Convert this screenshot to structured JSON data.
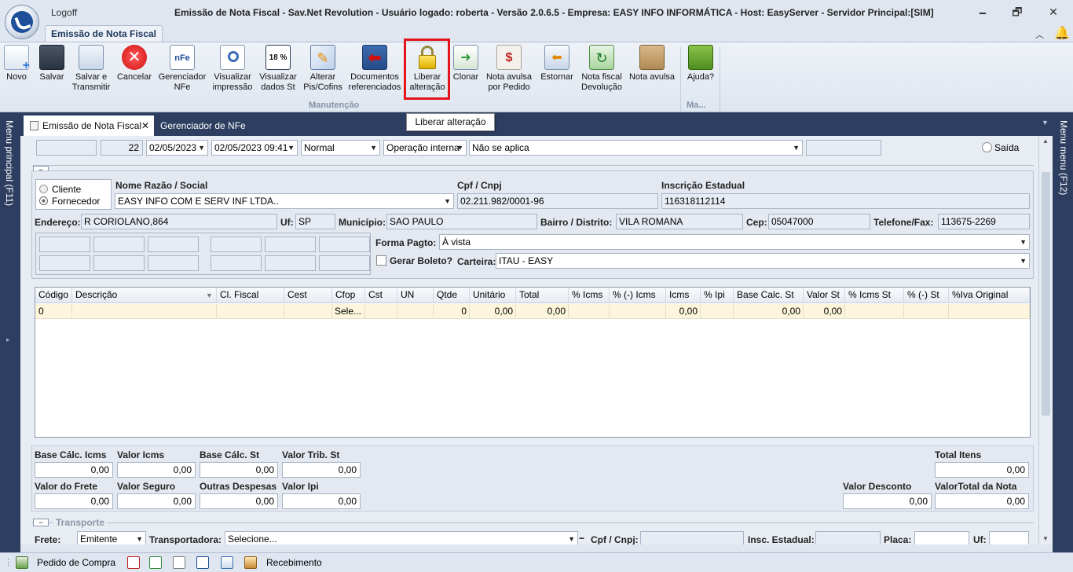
{
  "titlebar": {
    "logoff": "Logoff",
    "title": "Emissão de Nota Fiscal - Sav.Net Revolution - Usuário logado: roberta - Versão 2.0.6.5 - Empresa: EASY INFO INFORMÁTICA - Host: EasyServer - Servidor Principal:[SIM]",
    "min": "🗕",
    "max": "🗗",
    "close": "✕"
  },
  "ribbon": {
    "tab": "Emissão de Nota Fiscal",
    "buttons": [
      {
        "label": "Novo"
      },
      {
        "label": "Salvar"
      },
      {
        "label": "Salvar e Transmitir"
      },
      {
        "label": "Cancelar"
      },
      {
        "label": "Gerenciador NFe"
      },
      {
        "label": "Visualizar impressão"
      },
      {
        "label": "Visualizar dados St"
      },
      {
        "label": "Alterar Pis/Cofins"
      },
      {
        "label": "Documentos referenciados"
      },
      {
        "label": "Liberar alteração"
      },
      {
        "label": "Clonar"
      },
      {
        "label": "Nota avulsa por Pedido"
      },
      {
        "label": "Estornar"
      },
      {
        "label": "Nota fiscal Devolução"
      },
      {
        "label": "Nota avulsa"
      },
      {
        "label": "Ajuda?"
      }
    ],
    "group_main": "Manutenção",
    "group_help": "Ma..."
  },
  "tooltip": "Liberar alteração",
  "sidebars": {
    "left": "Menu principal (F11)",
    "right": "Menu menu (F12)"
  },
  "doc_tabs": [
    {
      "label": "Emissão de Nota Fiscal"
    },
    {
      "label": "Gerenciador de NFe"
    }
  ],
  "form": {
    "top": {
      "field1": "",
      "number": "22",
      "date1": "02/05/2023",
      "date2": "02/05/2023 09:41",
      "type": "Normal",
      "operation": "Operação interna",
      "apply": "Não se aplica",
      "field_extra": "",
      "saida": "Saída"
    },
    "radio_cliente": "Cliente",
    "radio_fornecedor": "Fornecedor",
    "nome_label": "Nome Razão / Social",
    "nome_value": "EASY INFO COM E SERV INF LTDA..",
    "cpf_label": "Cpf / Cnpj",
    "cpf_value": "02.211.982/0001-96",
    "ie_label": "Inscrição Estadual",
    "ie_value": "116318112114",
    "endereco_label": "Endereço:",
    "endereco_value": "R CORIOLANO,864",
    "uf_label": "Uf:",
    "uf_value": "SP",
    "municipio_label": "Município:",
    "municipio_value": "SAO PAULO",
    "bairro_label": "Bairro / Distrito:",
    "bairro_value": "VILA ROMANA",
    "cep_label": "Cep:",
    "cep_value": "05047000",
    "telefone_label": "Telefone/Fax:",
    "telefone_value": "113675-2269",
    "forma_label": "Forma Pagto:",
    "forma_value": "À vista",
    "boleto_label": "Gerar Boleto?",
    "carteira_label": "Carteira:",
    "carteira_value": "ITAU - EASY"
  },
  "grid": {
    "headers": [
      "Código",
      "Descrição",
      "Cl. Fiscal",
      "Cest",
      "Cfop",
      "Cst",
      "UN",
      "Qtde",
      "Unitário",
      "Total",
      "% Icms",
      "% (-) Icms",
      "Icms",
      "% Ipi",
      "Base Calc. St",
      "Valor St",
      "% Icms St",
      "% (-) St",
      "%Iva Original"
    ],
    "row": [
      "0",
      "",
      "",
      "",
      "Sele...",
      "",
      "",
      "0",
      "0,00",
      "0,00",
      "",
      "",
      "0,00",
      "",
      "0,00",
      "0,00",
      "",
      "",
      ""
    ]
  },
  "totals": {
    "base_icms_label": "Base Cálc. Icms",
    "base_icms": "0,00",
    "valor_icms_label": "Valor Icms",
    "valor_icms": "0,00",
    "base_st_label": "Base Cálc. St",
    "base_st": "0,00",
    "valor_trib_label": "Valor Trib. St",
    "valor_trib": "0,00",
    "total_itens_label": "Total Itens",
    "total_itens": "0,00",
    "frete_label": "Valor do Frete",
    "frete": "0,00",
    "seguro_label": "Valor Seguro",
    "seguro": "0,00",
    "outras_label": "Outras Despesas",
    "outras": "0,00",
    "ipi_label": "Valor Ipi",
    "ipi": "0,00",
    "desconto_label": "Valor Desconto",
    "desconto": "0,00",
    "total_nota_label": "ValorTotal da Nota",
    "total_nota": "0,00"
  },
  "transporte": {
    "title": "Transporte",
    "frete_label": "Frete:",
    "frete_value": "Emitente",
    "transportadora_label": "Transportadora:",
    "transportadora_value": "Selecione...",
    "cpf_label": "Cpf / Cnpj:",
    "insc_label": "Insc. Estadual:",
    "placa_label": "Placa:",
    "uf_label": "Uf:"
  },
  "statusbar": {
    "pedido": "Pedido de Compra",
    "recebimento": "Recebimento"
  },
  "colors": {
    "accent_dark": "#2d3e60",
    "highlight": "#e3141b",
    "grid_row": "#fdf6dc"
  }
}
